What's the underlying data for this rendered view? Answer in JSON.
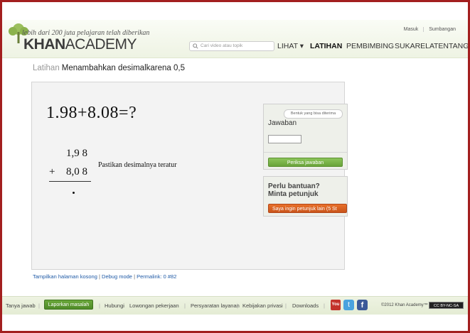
{
  "header": {
    "tagline": "lebih dari 200 juta pelajaran telah diberikan",
    "logo_bold": "KHAN",
    "logo_light": "ACADEMY",
    "top_links": [
      "Masuk",
      "Sumbangan"
    ],
    "search_placeholder": "Cari video atau topik",
    "nav": [
      {
        "label": "LIHAT ▾",
        "active": false
      },
      {
        "label": "LATIHAN",
        "active": true
      },
      {
        "label": "PEMBIMBING",
        "active": false
      },
      {
        "label": "SUKARELA",
        "active": false
      },
      {
        "label": "TENTANG",
        "active": false
      }
    ]
  },
  "breadcrumb": {
    "section": "Latihan",
    "title": "Menambahkan desimalkarena 0,5"
  },
  "exercise": {
    "problem": "1.98+8.08=?",
    "addend1": "1,9 8",
    "operator": "+",
    "addend2": "8,0 8",
    "instruction": "Pastikan desimalnya teratur"
  },
  "answer": {
    "accepted_formats": "Bentuk yang bisa diterima",
    "label": "Jawaban",
    "input_value": "",
    "check_button": "Periksa jawaban"
  },
  "help": {
    "title_line1": "Perlu bantuan?",
    "title_line2": "Minta petunjuk",
    "hint_button": "Saya ingin petunjuk lain (5 St"
  },
  "debug": {
    "links": [
      "Tampilkan halaman kosong",
      "Debug mode",
      "Permalink: 0 #82"
    ]
  },
  "footer": {
    "ask": "Tanya jawab",
    "report": "Laporkan masalah",
    "links": [
      "Hubungi",
      "Lowongan pekerjaan",
      "Persyaratan layanan",
      "Kebijakan privasi",
      "Downloads"
    ],
    "youtube": "You",
    "copyright": "©2012 Khan Academy™",
    "cc": "CC BY-NC-SA"
  },
  "colors": {
    "frame": "#a31f1f",
    "check_button": "#69a33a",
    "hint_button": "#e8702a",
    "link": "#1f5aa6"
  }
}
